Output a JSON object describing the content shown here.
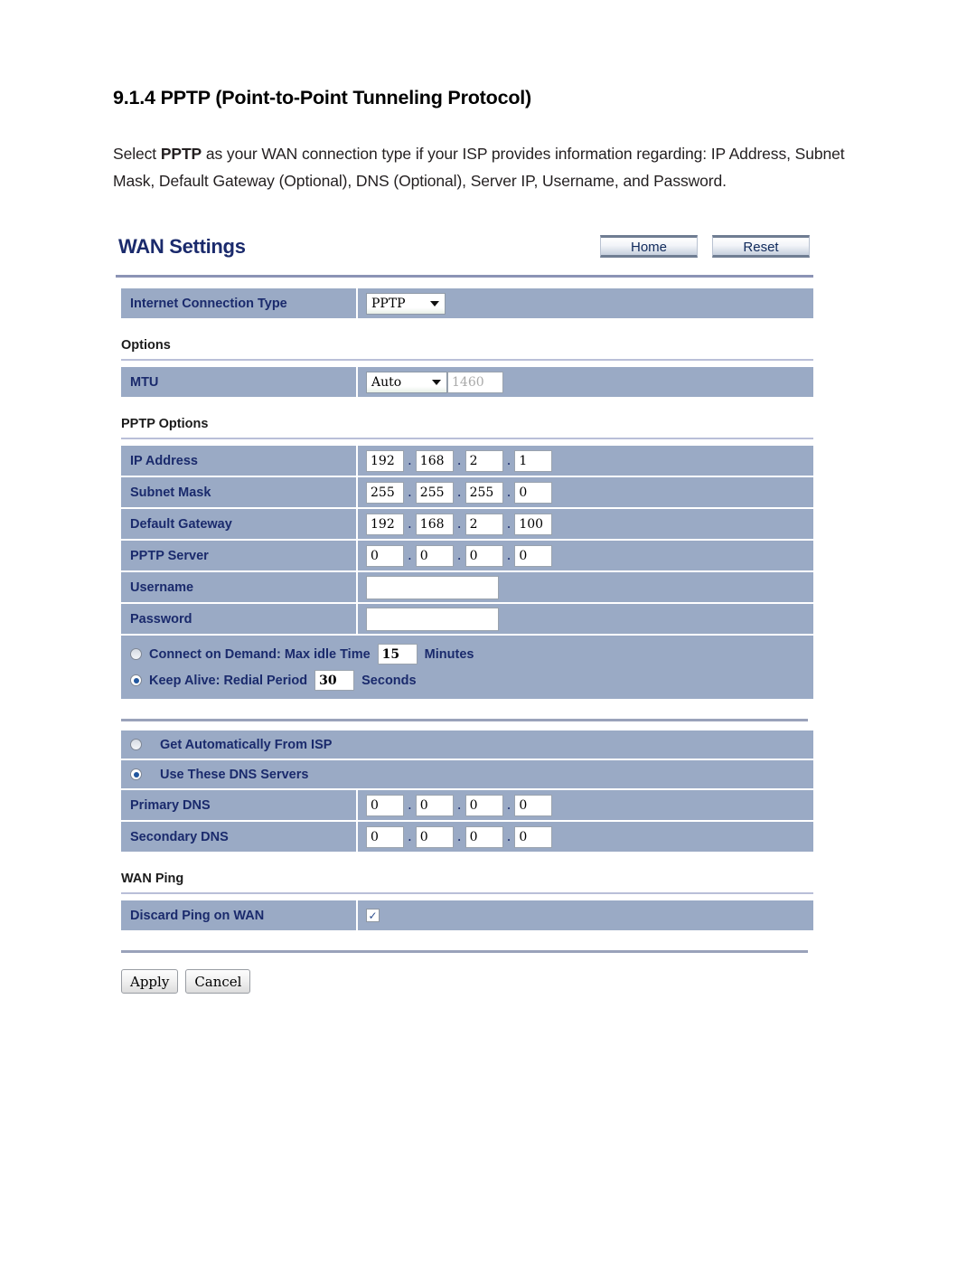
{
  "document": {
    "heading": "9.1.4 PPTP (Point-to-Point Tunneling Protocol)",
    "paragraph_part1": "Select ",
    "paragraph_bold": "PPTP",
    "paragraph_part2": " as your WAN connection type if your ISP provides information regarding: IP Address, Subnet Mask, Default Gateway (Optional), DNS (Optional), Server IP, Username, and Password."
  },
  "router": {
    "title": "WAN Settings",
    "header_buttons": [
      {
        "label": "Home"
      },
      {
        "label": "Reset"
      }
    ],
    "internet_connection_type": {
      "label": "Internet Connection Type",
      "value": "PPTP",
      "options": [
        "PPTP"
      ]
    },
    "options_section": {
      "heading": "Options",
      "mtu": {
        "label": "MTU",
        "mode": "Auto",
        "mode_options": [
          "Auto"
        ],
        "value": "1460"
      }
    },
    "pptp_section": {
      "heading": "PPTP Options",
      "ip_address": {
        "label": "IP Address",
        "octets": [
          "192",
          "168",
          "2",
          "1"
        ]
      },
      "subnet_mask": {
        "label": "Subnet Mask",
        "octets": [
          "255",
          "255",
          "255",
          "0"
        ]
      },
      "default_gateway": {
        "label": "Default Gateway",
        "octets": [
          "192",
          "168",
          "2",
          "100"
        ]
      },
      "pptp_server": {
        "label": "PPTP Server",
        "octets": [
          "0",
          "0",
          "0",
          "0"
        ]
      },
      "username": {
        "label": "Username",
        "value": ""
      },
      "password": {
        "label": "Password",
        "value": ""
      },
      "connect_on_demand": {
        "label": "Connect on Demand: Max idle Time",
        "value": "15",
        "unit": "Minutes",
        "selected": false
      },
      "keep_alive": {
        "label": "Keep Alive: Redial Period",
        "value": "30",
        "unit": "Seconds",
        "selected": true
      }
    },
    "dns_section": {
      "get_automatically": {
        "label": "Get Automatically From ISP",
        "selected": false
      },
      "use_these": {
        "label": "Use These DNS Servers",
        "selected": true
      },
      "primary_dns": {
        "label": "Primary DNS",
        "octets": [
          "0",
          "0",
          "0",
          "0"
        ]
      },
      "secondary_dns": {
        "label": "Secondary DNS",
        "octets": [
          "0",
          "0",
          "0",
          "0"
        ]
      }
    },
    "wan_ping_section": {
      "heading": "WAN Ping",
      "discard_ping": {
        "label": "Discard Ping on WAN",
        "checked": true,
        "glyph": "✓"
      }
    },
    "footer_buttons": [
      {
        "label": "Apply"
      },
      {
        "label": "Cancel"
      }
    ]
  }
}
